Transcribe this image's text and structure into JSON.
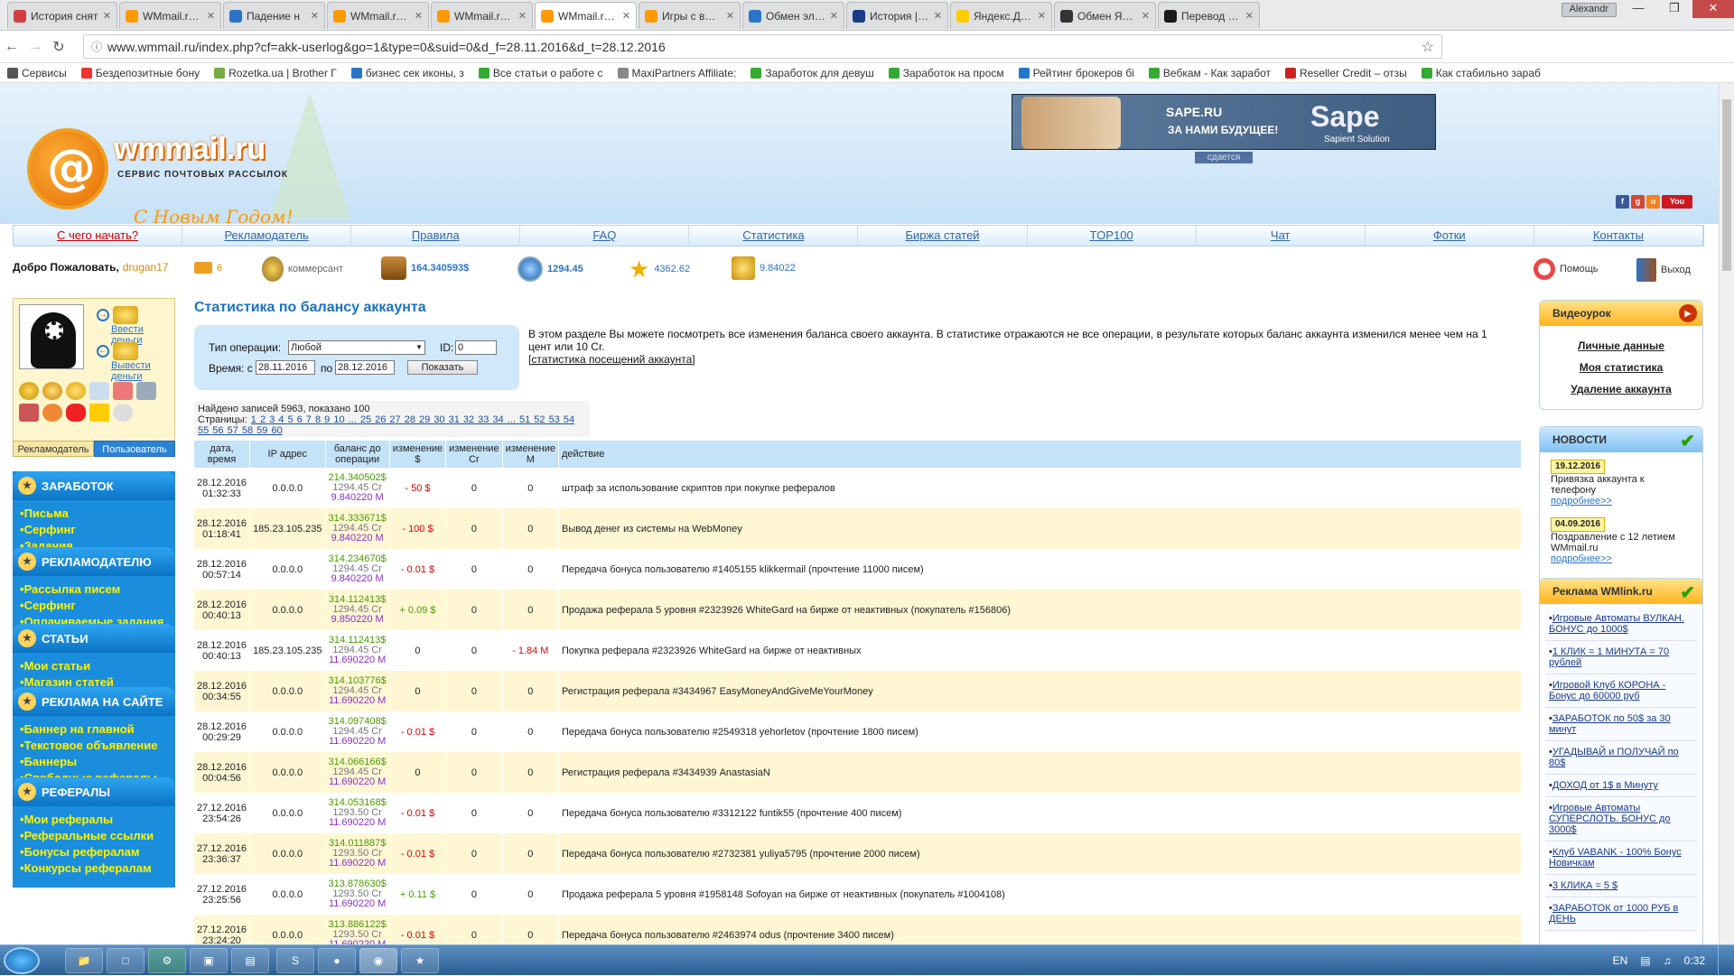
{
  "browser": {
    "tabs": [
      {
        "title": "История снят",
        "color": "#d04040"
      },
      {
        "title": "WMmail.ru - с",
        "color": "#ff9a00"
      },
      {
        "title": "Падение н",
        "color": "#2a74c8"
      },
      {
        "title": "WMmail.ru - о",
        "color": "#ff9a00"
      },
      {
        "title": "WMmail.ru - с",
        "color": "#ff9a00"
      },
      {
        "title": "WMmail.ru - с",
        "color": "#ff9a00"
      },
      {
        "title": "Игры с вывод",
        "color": "#ff9a00"
      },
      {
        "title": "Обмен электр",
        "color": "#2a74c8"
      },
      {
        "title": "История | Pay",
        "color": "#1a3a8a"
      },
      {
        "title": "Яндекс.Деньг",
        "color": "#ffcc00"
      },
      {
        "title": "Обмен Яндек",
        "color": "#333333"
      },
      {
        "title": "Перевод из с",
        "color": "#1a1a1a"
      }
    ],
    "user": "Alexandr",
    "url": "www.wmmail.ru/index.php?cf=akk-userlog&go=1&type=0&suid=0&d_f=28.11.2016&d_t=28.12.2016",
    "bookmarks": [
      "Сервисы",
      "Бездепозитные бону",
      "Rozetka.ua | Brother Г",
      "бизнес сек иконы, з",
      "Все статьи о работе с",
      "MaxiPartners Affiliate:",
      "Заработок для девуш",
      "Заработок на просм",
      "Рейтинг брокеров бі",
      "Вебкам - Как заработ",
      "Reseller Credit – отзы",
      "Как стабильно зараб"
    ]
  },
  "header": {
    "logo_text": "wmmail.ru",
    "logo_sub": "СЕРВИС ПОЧТОВЫХ РАССЫЛОК",
    "logo_ny": "С Новым Годом!",
    "banner_t1": "SAPE.RU",
    "banner_t2": "ЗА НАМИ БУДУЩЕЕ!",
    "banner_big": "Sape",
    "banner_sm": "Sapient Solution",
    "banner_note": "сдается"
  },
  "nav": [
    "С чего начать?",
    "Рекламодатель",
    "Правила",
    "FAQ",
    "Статистика",
    "Биржа статей",
    "TOP100",
    "Чат",
    "Фотки",
    "Контакты"
  ],
  "userbar": {
    "welcome": "Добро Пожаловать,",
    "username": "drugan17",
    "mail_count": "6",
    "status": "коммерсант",
    "balance_usd": "164.340593$",
    "balance_cr": "1294.45",
    "rating": "4362.62",
    "balance_m": "9.84022",
    "help": "Помощь",
    "exit": "Выход"
  },
  "sidebar": {
    "deposit": "Ввести деньги",
    "withdraw": "Вывести деньги",
    "role_adv": "Рекламодатель",
    "role_user": "Пользователь",
    "sections": [
      {
        "title": "ЗАРАБОТОК",
        "items": [
          "Письма",
          "Серфинг",
          "Задания"
        ]
      },
      {
        "title": "РЕКЛАМОДАТЕЛЮ",
        "items": [
          "Рассылка писем",
          "Серфинг",
          "Оплачиваемые задания"
        ]
      },
      {
        "title": "СТАТЬИ",
        "items": [
          "Мои статьи",
          "Магазин статей"
        ]
      },
      {
        "title": "РЕКЛАМА НА САЙТЕ",
        "items": [
          "Баннер на главной",
          "Текстовое объявление",
          "Баннеры",
          "Свободные рефералы"
        ]
      },
      {
        "title": "РЕФЕРАЛЫ",
        "items": [
          "Мои рефералы",
          "Реферальные ссылки",
          "Бонусы рефералам",
          "Конкурсы рефералам"
        ]
      }
    ]
  },
  "main": {
    "title": "Статистика по балансу аккаунта",
    "filter": {
      "type_label": "Тип операции:",
      "type_value": "Любой",
      "id_label": "ID:",
      "id_value": "0",
      "time_label": "Время: с",
      "from": "28.11.2016",
      "to_label": "по",
      "to": "28.12.2016",
      "show": "Показать"
    },
    "desc": "В этом разделе Вы можете посмотреть все изменения баланса своего аккаунта. В статистике отражаются не все операции, в результате которых баланс аккаунта изменился менее чем на 1 цент или 10 Cr.",
    "desc_link": "[статистика посещений аккаунта]",
    "found": "Найдено записей 5963, показано 100",
    "pages_label": "Страницы:",
    "pages": "1 2 3 4 5 6 7 8 9 10 ... 25 26 27 28 29 30 31 32 33 34 ... 51 52 53 54 55 56 57 58 59 60",
    "columns": [
      "дата, время",
      "IP адрес",
      "баланс до операции",
      "изменение $",
      "изменение Cr",
      "изменение M",
      "действие"
    ],
    "rows": [
      {
        "date": "28.12.2016",
        "time": "01:32:33",
        "ip": "0.0.0.0",
        "bd": "214.340502$",
        "bc": "1294.45 Cr",
        "bm": "9.840220 M",
        "cd": "- 50 $",
        "cc": "0",
        "cm": "0",
        "act": "штраф за использование скриптов при покупке рефералов"
      },
      {
        "date": "28.12.2016",
        "time": "01:18:41",
        "ip": "185.23.105.235",
        "bd": "314.333671$",
        "bc": "1294.45 Cr",
        "bm": "9.840220 M",
        "cd": "- 100 $",
        "cc": "0",
        "cm": "0",
        "act": "Вывод денег из системы на WebMoney"
      },
      {
        "date": "28.12.2016",
        "time": "00:57:14",
        "ip": "0.0.0.0",
        "bd": "314.234670$",
        "bc": "1294.45 Cr",
        "bm": "9.840220 M",
        "cd": "- 0.01 $",
        "cc": "0",
        "cm": "0",
        "act": "Передача бонуса пользователю #1405155 klikkermail (прочтение 11000 писем)"
      },
      {
        "date": "28.12.2016",
        "time": "00:40:13",
        "ip": "0.0.0.0",
        "bd": "314.112413$",
        "bc": "1294.45 Cr",
        "bm": "9.850220 M",
        "cd": "+ 0.09 $",
        "cc": "0",
        "cm": "0",
        "act": "Продажа реферала 5 уровня #2323926 WhiteGard на бирже от неактивных (покупатель #156806)"
      },
      {
        "date": "28.12.2016",
        "time": "00:40:13",
        "ip": "185.23.105.235",
        "bd": "314.112413$",
        "bc": "1294.45 Cr",
        "bm": "11.690220 M",
        "cd": "0",
        "cc": "0",
        "cm": "- 1.84 M",
        "act": "Покупка реферала #2323926 WhiteGard на бирже от неактивных"
      },
      {
        "date": "28.12.2016",
        "time": "00:34:55",
        "ip": "0.0.0.0",
        "bd": "314.103776$",
        "bc": "1294.45 Cr",
        "bm": "11.690220 M",
        "cd": "0",
        "cc": "0",
        "cm": "0",
        "act": "Регистрация реферала #3434967 EasyMoneyAndGiveMeYourMoney"
      },
      {
        "date": "28.12.2016",
        "time": "00:29:29",
        "ip": "0.0.0.0",
        "bd": "314.097408$",
        "bc": "1294.45 Cr",
        "bm": "11.690220 M",
        "cd": "- 0.01 $",
        "cc": "0",
        "cm": "0",
        "act": "Передача бонуса пользователю #2549318 yehorletov (прочтение 1800 писем)"
      },
      {
        "date": "28.12.2016",
        "time": "00:04:56",
        "ip": "0.0.0.0",
        "bd": "314.066166$",
        "bc": "1294.45 Cr",
        "bm": "11.690220 M",
        "cd": "0",
        "cc": "0",
        "cm": "0",
        "act": "Регистрация реферала #3434939 AnastasiaN"
      },
      {
        "date": "27.12.2016",
        "time": "23:54:26",
        "ip": "0.0.0.0",
        "bd": "314.053168$",
        "bc": "1293.50 Cr",
        "bm": "11.690220 M",
        "cd": "- 0.01 $",
        "cc": "0",
        "cm": "0",
        "act": "Передача бонуса пользователю #3312122 funtik55 (прочтение 400 писем)"
      },
      {
        "date": "27.12.2016",
        "time": "23:36:37",
        "ip": "0.0.0.0",
        "bd": "314.011887$",
        "bc": "1293.50 Cr",
        "bm": "11.690220 M",
        "cd": "- 0.01 $",
        "cc": "0",
        "cm": "0",
        "act": "Передача бонуса пользователю #2732381 yuliya5795 (прочтение 2000 писем)"
      },
      {
        "date": "27.12.2016",
        "time": "23:25:56",
        "ip": "0.0.0.0",
        "bd": "313.878630$",
        "bc": "1293.50 Cr",
        "bm": "11.690220 M",
        "cd": "+ 0.11 $",
        "cc": "0",
        "cm": "0",
        "act": "Продажа реферала 5 уровня #1958148 Sofoyan на бирже от неактивных (покупатель #1004108)"
      },
      {
        "date": "27.12.2016",
        "time": "23:24:20",
        "ip": "0.0.0.0",
        "bd": "313.886122$",
        "bc": "1293.50 Cr",
        "bm": "11.690220 M",
        "cd": "- 0.01 $",
        "cc": "0",
        "cm": "0",
        "act": "Передача бонуса пользователю #2463974 odus (прочтение 3400 писем)"
      }
    ]
  },
  "right": {
    "video": "Видеоурок",
    "links": [
      "Личные данные",
      "Моя статистика",
      "Удаление аккаунта"
    ],
    "news_title": "НОВОСТИ",
    "news": [
      {
        "date": "19.12.2016",
        "text": "Привязка аккаунта к телефону",
        "more": "подробнее>>"
      },
      {
        "date": "04.09.2016",
        "text": "Поздравление с 12 летием WMmail.ru",
        "more": "подробнее>>"
      }
    ],
    "ads_title": "Реклама WMlink.ru",
    "ads": [
      "Игровые Автоматы ВУЛКАН. БОНУС до 1000$",
      "1 КЛИК = 1 МИНУТА = 70 рублей",
      "Игровой Клуб КОРОНА - Бонус до 60000 руб",
      "ЗАРАБОТОК по 50$ за 30 минут",
      "УГАДЫВАЙ и ПОЛУЧАЙ по 80$",
      "ДОХОД от 1$ в Минуту",
      "Игровые Автоматы СУПЕРСЛОТЬ. БОНУС до 3000$",
      "Клуб VABANK - 100% Бонус Новичкам",
      "3 КЛИКА = 5 $",
      "ЗАРАБОТОК от 1000 РУБ в ДЕНЬ"
    ]
  },
  "taskbar": {
    "lang": "EN",
    "clock": "0:32"
  }
}
